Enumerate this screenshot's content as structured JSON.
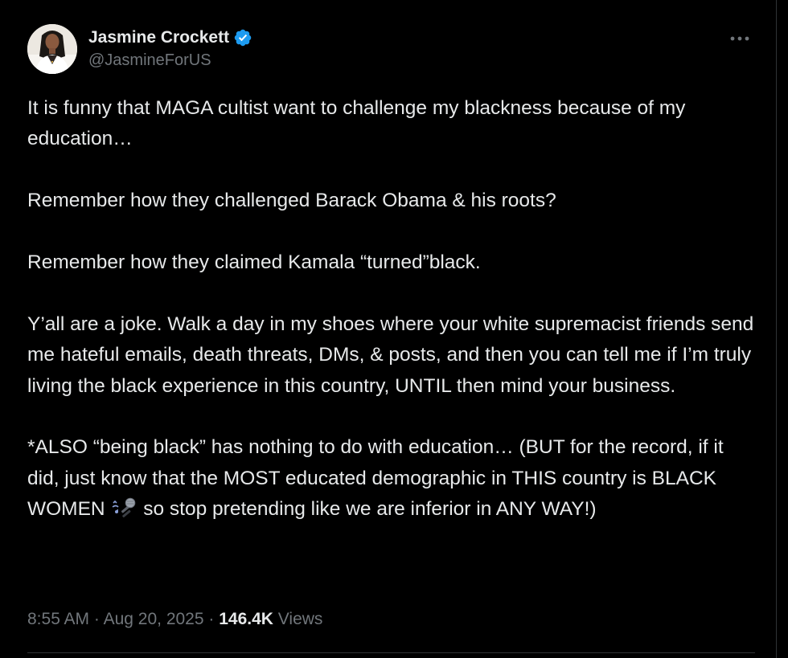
{
  "author": {
    "display_name": "Jasmine Crockett",
    "handle": "@JasmineForUS",
    "verified_icon": "verified-badge-icon",
    "verified_color": "#1d9bf0"
  },
  "tweet": {
    "paragraphs": [
      "It is funny that MAGA cultist want to challenge my blackness because of my education…",
      "Remember how they challenged Barack Obama & his roots?",
      "Remember how they claimed Kamala “turned”black.",
      "Y’all are a joke. Walk a day in my shoes where your white supremacist friends send me hateful emails, death threats, DMs, & posts, and then you can tell me if I’m truly living the black experience in this country, UNTIL then mind your business."
    ],
    "last_paragraph_before_emoji": "*ALSO “being black” has nothing to do with education… (BUT for the record, if it did, just know that the MOST educated demographic in THIS country is BLACK WOMEN",
    "emoji": "microphone-emoji",
    "last_paragraph_after_emoji": "so stop pretending like we are inferior in ANY WAY!)"
  },
  "meta": {
    "time": "8:55 AM",
    "separator": "·",
    "date": "Aug 20, 2025",
    "views_count": "146.4K",
    "views_label": "Views"
  },
  "colors": {
    "background": "#000000",
    "text": "#e7e9ea",
    "secondary": "#71767b",
    "border": "#2f3336"
  }
}
